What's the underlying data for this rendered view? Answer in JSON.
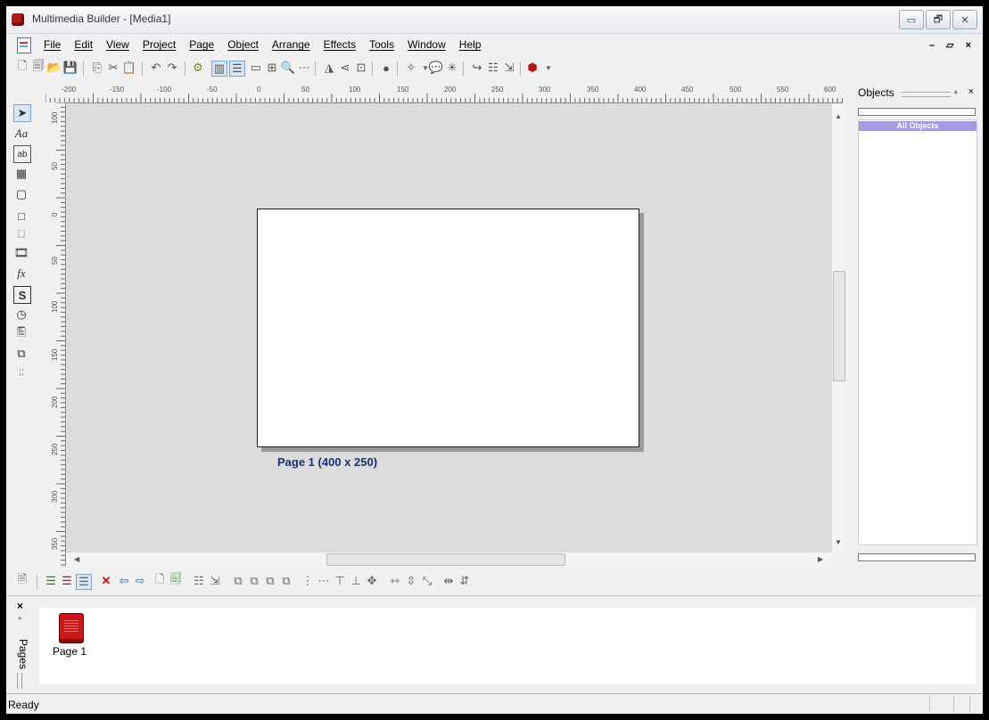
{
  "window": {
    "title": "Multimedia Builder - [Media1]",
    "controls": {
      "minimize": "▭",
      "restore": "🗗",
      "close": "✕"
    }
  },
  "menubar": {
    "items": [
      "File",
      "Edit",
      "View",
      "Project",
      "Page",
      "Object",
      "Arrange",
      "Effects",
      "Tools",
      "Window",
      "Help"
    ],
    "mdi_controls": "– ▱ ×"
  },
  "ruler": {
    "h_labels": [
      "-200",
      "-150",
      "-100",
      "-50",
      "0",
      "50",
      "100",
      "150",
      "200",
      "250",
      "300",
      "350",
      "400",
      "450",
      "500",
      "550",
      "600"
    ],
    "v_labels": [
      "100",
      "50",
      "0",
      "50",
      "100",
      "150",
      "200",
      "250",
      "300",
      "350"
    ]
  },
  "canvas": {
    "page_label": "Page 1 (400 x 250)"
  },
  "objects_panel": {
    "title": "Objects",
    "selected_item": "All Objects"
  },
  "pages_panel": {
    "tab_label": "Pages",
    "items": [
      {
        "label": "Page 1"
      }
    ]
  },
  "statusbar": {
    "text": "Ready"
  },
  "colors": {
    "selection": "#a39be0",
    "page_label": "#1c2f6e",
    "canvas_bg": "#dcdcdc"
  }
}
